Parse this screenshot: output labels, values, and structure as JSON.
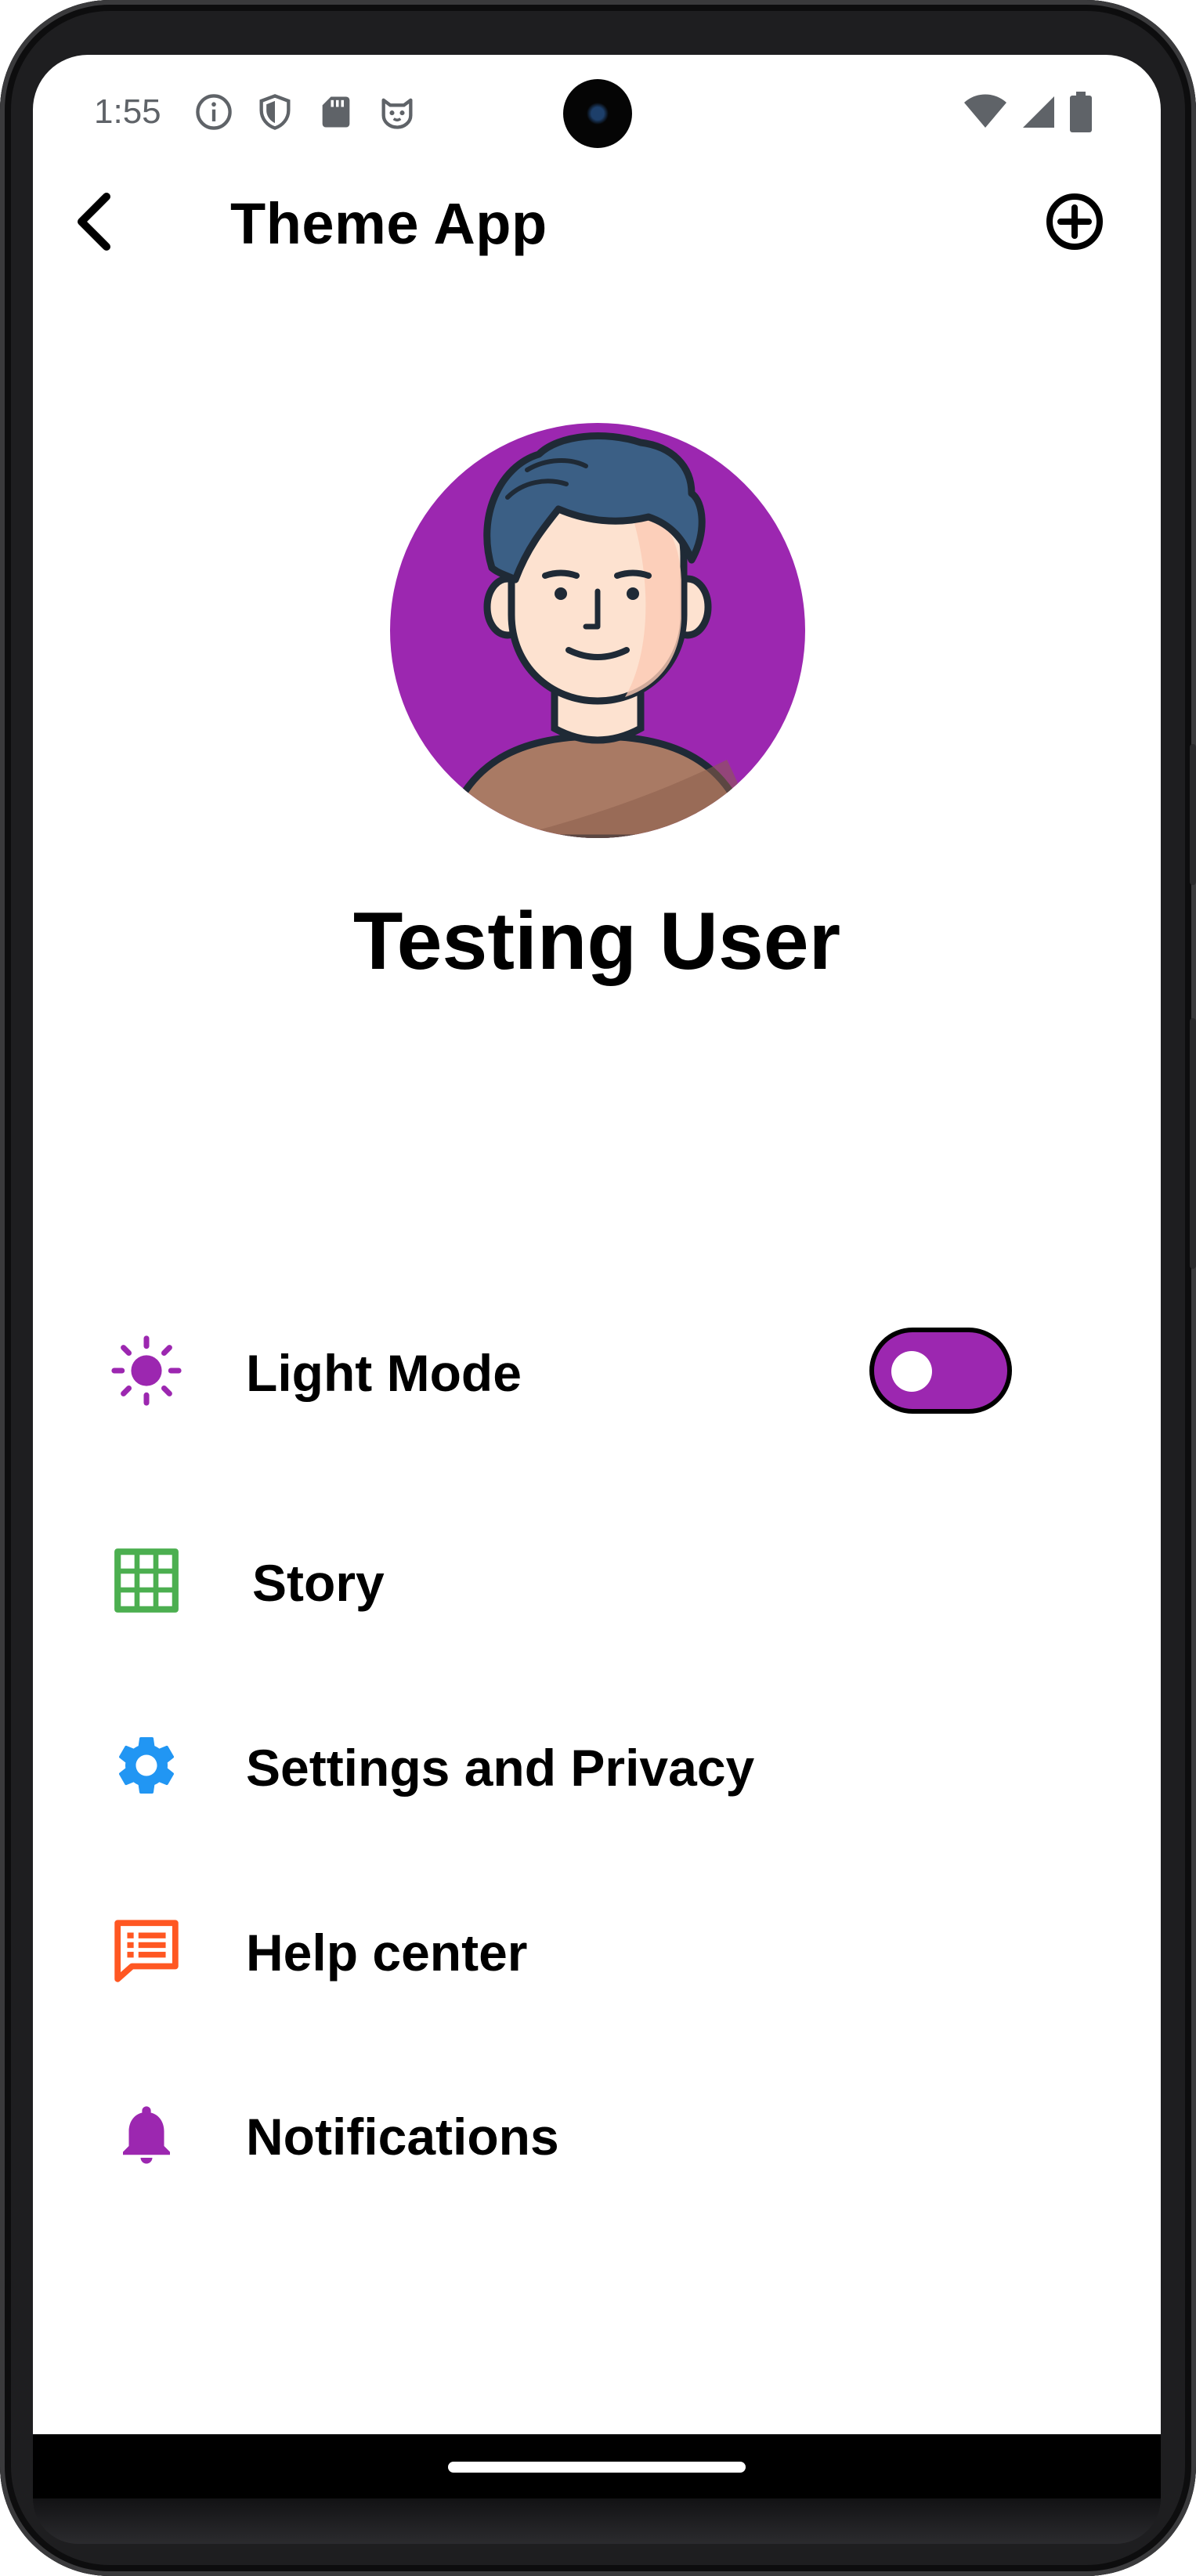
{
  "status_bar": {
    "time": "1:55",
    "left_icons": [
      "info-icon",
      "shield-icon",
      "sd-card-icon",
      "cat-face-icon"
    ],
    "right_icons": [
      "wifi-icon",
      "cell-signal-icon",
      "battery-icon"
    ]
  },
  "app_bar": {
    "title": "Theme App",
    "back_icon": "chevron-left-icon",
    "action_icon": "add-circle-icon"
  },
  "profile": {
    "name": "Testing User",
    "avatar_bg": "#9c27b0"
  },
  "menu": {
    "items": [
      {
        "id": "light-mode",
        "label": "Light Mode",
        "icon": "sun-icon",
        "icon_color": "#9c27b0",
        "toggle_on": true
      },
      {
        "id": "story",
        "label": "Story",
        "icon": "grid-icon",
        "icon_color": "#4caf50"
      },
      {
        "id": "settings",
        "label": "Settings and Privacy",
        "icon": "gear-icon",
        "icon_color": "#2196f3"
      },
      {
        "id": "help",
        "label": "Help center",
        "icon": "chat-list-icon",
        "icon_color": "#ff5722"
      },
      {
        "id": "notifications",
        "label": "Notifications",
        "icon": "bell-icon",
        "icon_color": "#9c27b0"
      }
    ]
  },
  "colors": {
    "accent": "#9c27b0",
    "toggle_track": "#9c27b0"
  }
}
